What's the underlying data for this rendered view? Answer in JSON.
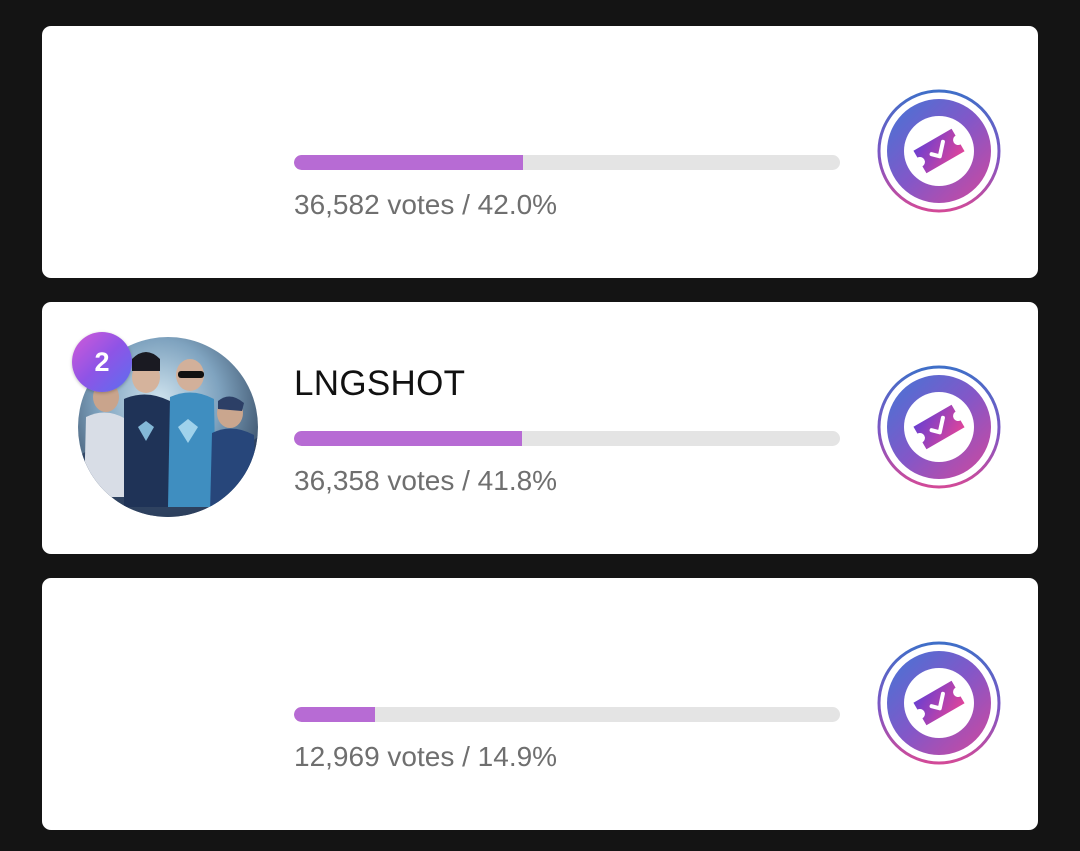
{
  "colors": {
    "page_background": "#141414",
    "card_background": "#ffffff",
    "bar_fill": "#b76bd4",
    "bar_track": "#e4e4e4",
    "vote_text": "#6f6f6f",
    "badge_gradient": [
      "#d25ad8",
      "#5a6ff0"
    ]
  },
  "candidates": [
    {
      "name": "",
      "rank": "",
      "votes_text": "36,582 votes / 42.0%",
      "percent": 42.0,
      "vote_icon": "ticket-check-icon"
    },
    {
      "name": "LNGSHOT",
      "rank": "2",
      "votes_text": "36,358 votes / 41.8%",
      "percent": 41.8,
      "vote_icon": "ticket-check-icon"
    },
    {
      "name": "",
      "rank": "",
      "votes_text": "12,969 votes / 14.9%",
      "percent": 14.9,
      "vote_icon": "ticket-check-icon"
    }
  ]
}
